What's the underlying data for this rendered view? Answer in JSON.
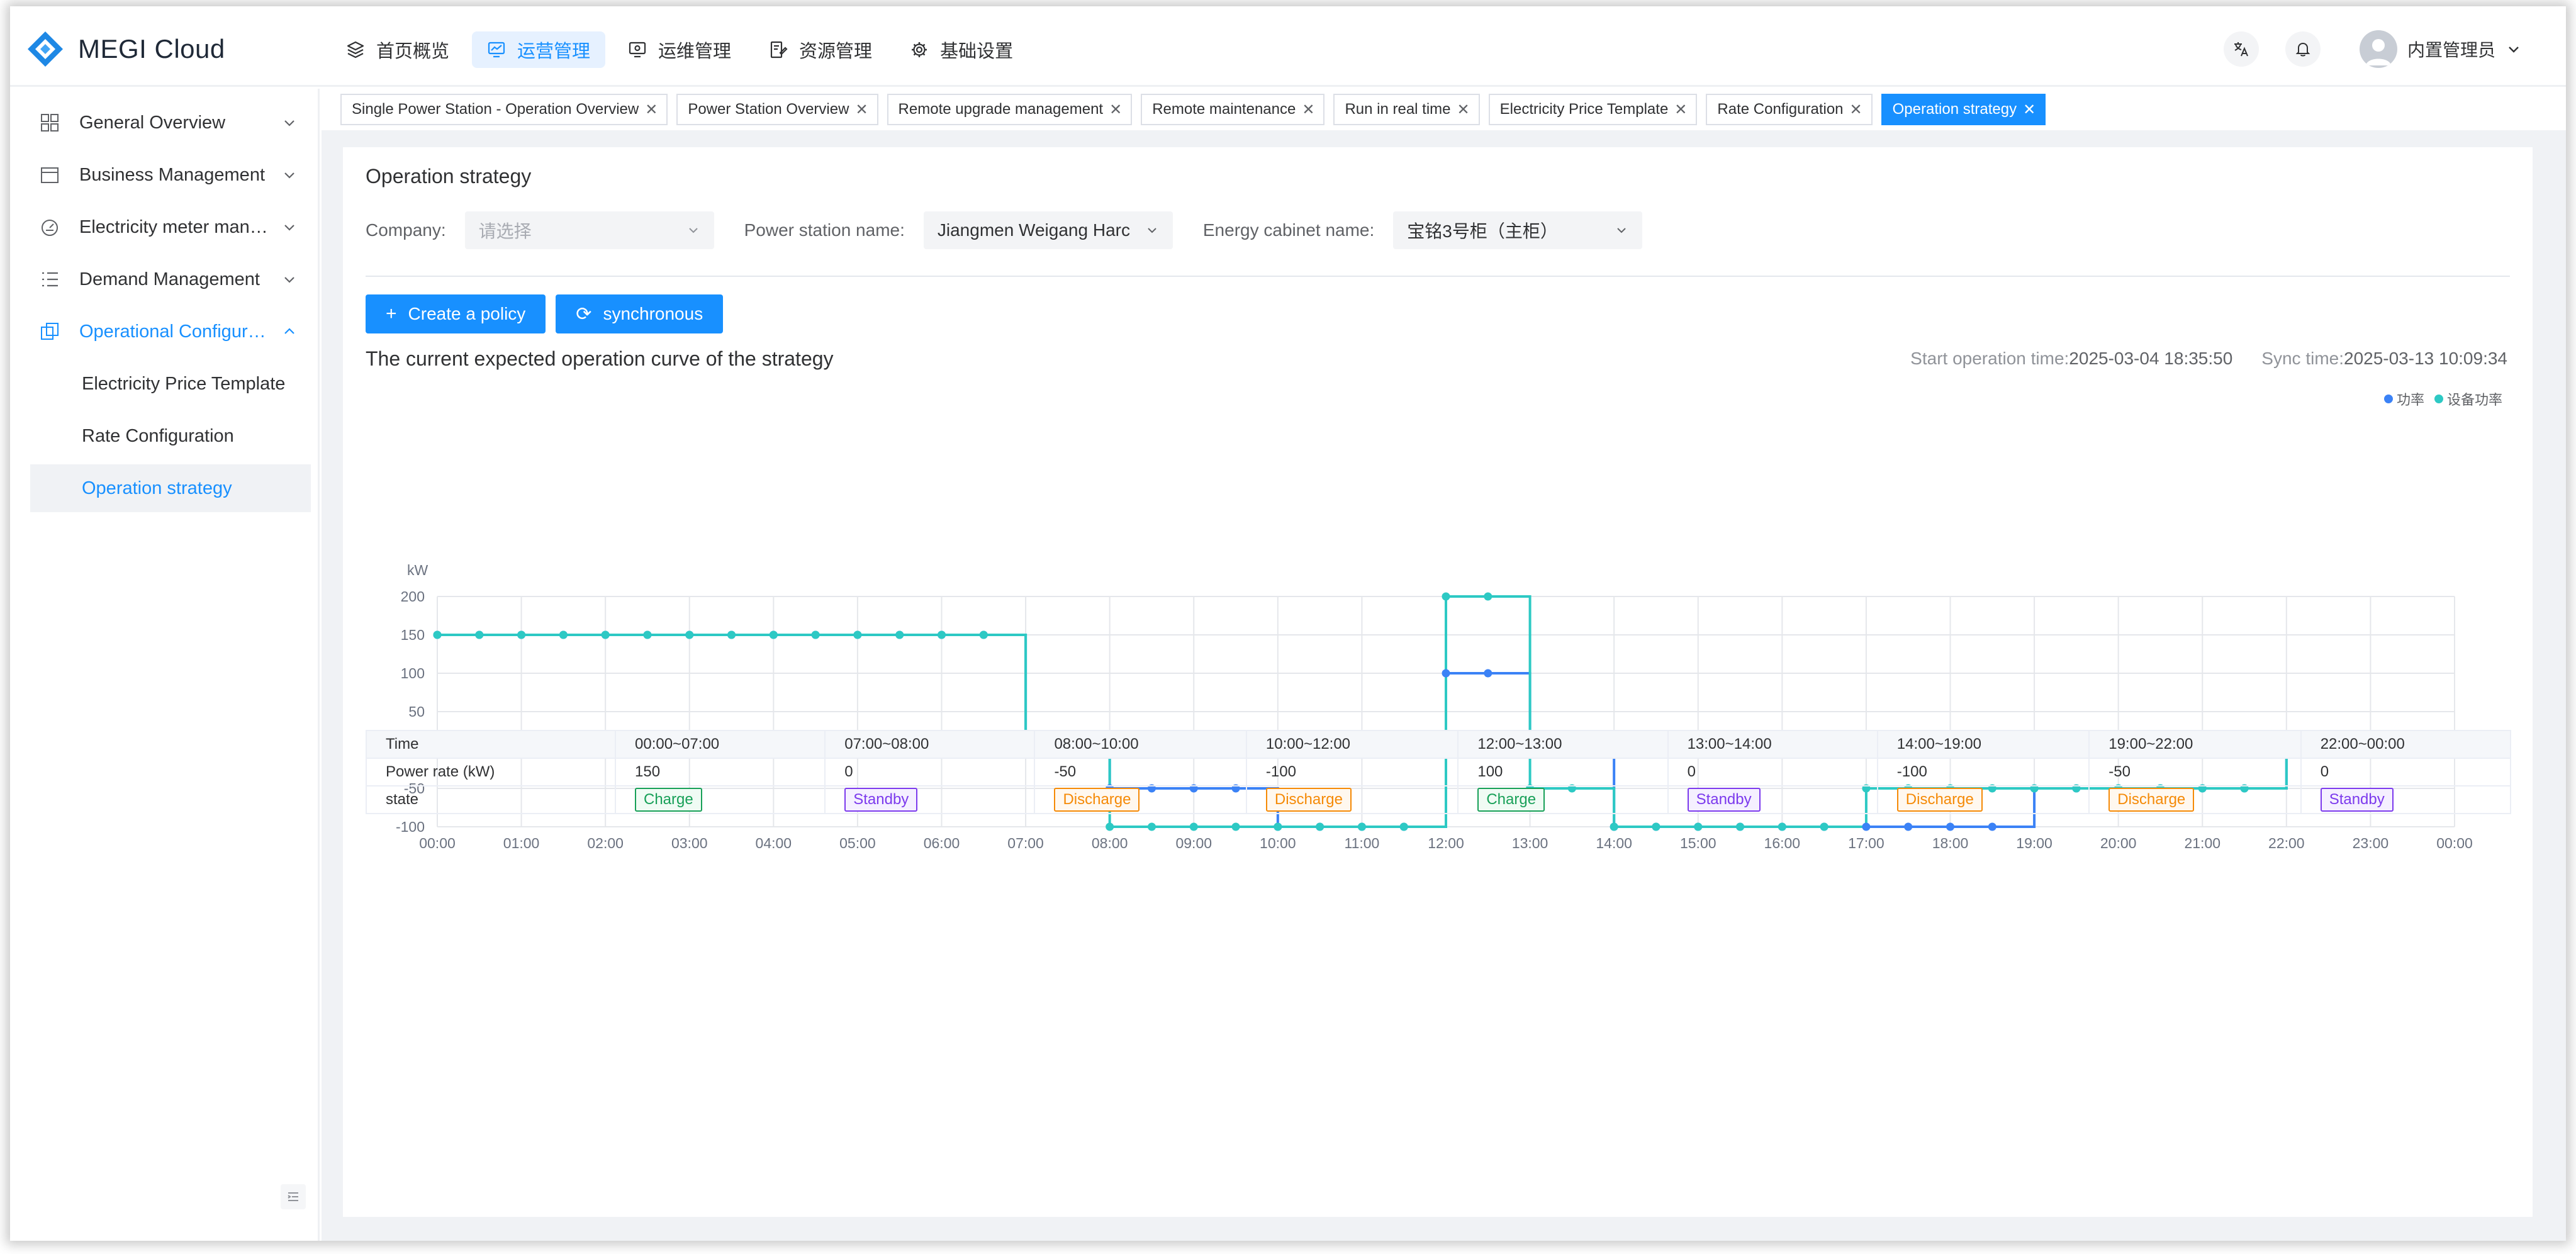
{
  "app": {
    "name": "MEGI Cloud"
  },
  "topnav": [
    {
      "label": "首页概览",
      "icon": "layers-icon",
      "active": false
    },
    {
      "label": "运营管理",
      "icon": "monitor-chart-icon",
      "active": true
    },
    {
      "label": "运维管理",
      "icon": "maintenance-icon",
      "active": false
    },
    {
      "label": "资源管理",
      "icon": "resource-icon",
      "active": false
    },
    {
      "label": "基础设置",
      "icon": "gear-icon",
      "active": false
    }
  ],
  "header": {
    "user_name": "内置管理员"
  },
  "sidebar": {
    "items": [
      {
        "label": "General Overview",
        "icon": "grid-icon",
        "expanded": false
      },
      {
        "label": "Business Management",
        "icon": "calendar-icon",
        "expanded": false
      },
      {
        "label": "Electricity meter mana...",
        "icon": "meter-icon",
        "expanded": false
      },
      {
        "label": "Demand Management",
        "icon": "list-icon",
        "expanded": false
      },
      {
        "label": "Operational Configura...",
        "icon": "config-icon",
        "expanded": true
      }
    ],
    "subitems": [
      {
        "label": "Electricity Price Template",
        "active": false
      },
      {
        "label": "Rate Configuration",
        "active": false
      },
      {
        "label": "Operation strategy",
        "active": true
      }
    ]
  },
  "tabs": [
    {
      "label": "Single Power Station - Operation Overview",
      "active": false
    },
    {
      "label": "Power Station Overview",
      "active": false
    },
    {
      "label": "Remote upgrade management",
      "active": false
    },
    {
      "label": "Remote maintenance",
      "active": false
    },
    {
      "label": "Run in real time",
      "active": false
    },
    {
      "label": "Electricity Price Template",
      "active": false
    },
    {
      "label": "Rate Configuration",
      "active": false
    },
    {
      "label": "Operation strategy",
      "active": true
    }
  ],
  "page": {
    "title": "Operation strategy",
    "filters": {
      "company_label": "Company:",
      "company_placeholder": "请选择",
      "station_label": "Power station name:",
      "station_value": "Jiangmen Weigang Harc",
      "cabinet_label": "Energy cabinet name:",
      "cabinet_value": "宝铭3号柜（主柜）"
    },
    "buttons": {
      "create": "Create a policy",
      "sync": "synchronous"
    },
    "section_title": "The current expected operation curve of the strategy",
    "start_label": "Start operation time:",
    "start_value": "2025-03-04 18:35:50",
    "sync_label": "Sync time:",
    "sync_value": "2025-03-13 10:09:34"
  },
  "chart_data": {
    "type": "line",
    "step": true,
    "ylabel": "kW",
    "ylim": [
      -100,
      200
    ],
    "yticks": [
      200,
      150,
      100,
      50,
      0,
      -50,
      -100
    ],
    "xticks": [
      "00:00",
      "01:00",
      "02:00",
      "03:00",
      "04:00",
      "05:00",
      "06:00",
      "07:00",
      "08:00",
      "09:00",
      "10:00",
      "11:00",
      "12:00",
      "13:00",
      "14:00",
      "15:00",
      "16:00",
      "17:00",
      "18:00",
      "19:00",
      "20:00",
      "21:00",
      "22:00",
      "23:00",
      "00:00"
    ],
    "x_hours": [
      0,
      0.5,
      1,
      1.5,
      2,
      2.5,
      3,
      3.5,
      4,
      4.5,
      5,
      5.5,
      6,
      6.5,
      7,
      7.5,
      8,
      8.5,
      9,
      9.5,
      10,
      10.5,
      11,
      11.5,
      12,
      12.5,
      13,
      13.5,
      14,
      14.5,
      15,
      15.5,
      16,
      16.5,
      17,
      17.5,
      18,
      18.5,
      19,
      19.5,
      20,
      20.5,
      21,
      21.5,
      22,
      22.5,
      23,
      23.5,
      24
    ],
    "legend_position": "top-right",
    "series": [
      {
        "name": "功率",
        "color": "#3b82f6",
        "values": [
          150,
          150,
          150,
          150,
          150,
          150,
          150,
          150,
          150,
          150,
          150,
          150,
          150,
          150,
          0,
          0,
          -50,
          -50,
          -50,
          -50,
          -100,
          -100,
          -100,
          -100,
          100,
          100,
          0,
          0,
          -100,
          -100,
          -100,
          -100,
          -100,
          -100,
          -100,
          -100,
          -100,
          -100,
          -50,
          -50,
          -50,
          -50,
          -50,
          -50,
          0,
          0,
          0,
          0,
          0
        ]
      },
      {
        "name": "设备功率",
        "color": "#2dc9c4",
        "values": [
          150,
          150,
          150,
          150,
          150,
          150,
          150,
          150,
          150,
          150,
          150,
          150,
          150,
          150,
          0,
          0,
          -100,
          -100,
          -100,
          -100,
          -100,
          -100,
          -100,
          -100,
          200,
          200,
          -50,
          -50,
          -100,
          -100,
          -100,
          -100,
          -100,
          -100,
          -50,
          -50,
          -50,
          -50,
          -50,
          -50,
          -50,
          -50,
          -50,
          -50,
          0,
          0,
          0,
          0,
          0
        ]
      }
    ]
  },
  "table": {
    "row_labels": [
      "Time",
      "Power rate (kW)",
      "state"
    ],
    "columns": [
      {
        "time": "00:00~07:00",
        "power": "150",
        "state": "Charge"
      },
      {
        "time": "07:00~08:00",
        "power": "0",
        "state": "Standby"
      },
      {
        "time": "08:00~10:00",
        "power": "-50",
        "state": "Discharge"
      },
      {
        "time": "10:00~12:00",
        "power": "-100",
        "state": "Discharge"
      },
      {
        "time": "12:00~13:00",
        "power": "100",
        "state": "Charge"
      },
      {
        "time": "13:00~14:00",
        "power": "0",
        "state": "Standby"
      },
      {
        "time": "14:00~19:00",
        "power": "-100",
        "state": "Discharge"
      },
      {
        "time": "19:00~22:00",
        "power": "-50",
        "state": "Discharge"
      },
      {
        "time": "22:00~00:00",
        "power": "0",
        "state": "Standby"
      }
    ]
  },
  "colors": {
    "primary": "#1890ff",
    "charge": "#18a058",
    "standby": "#7c3aed",
    "discharge": "#f58a07"
  }
}
